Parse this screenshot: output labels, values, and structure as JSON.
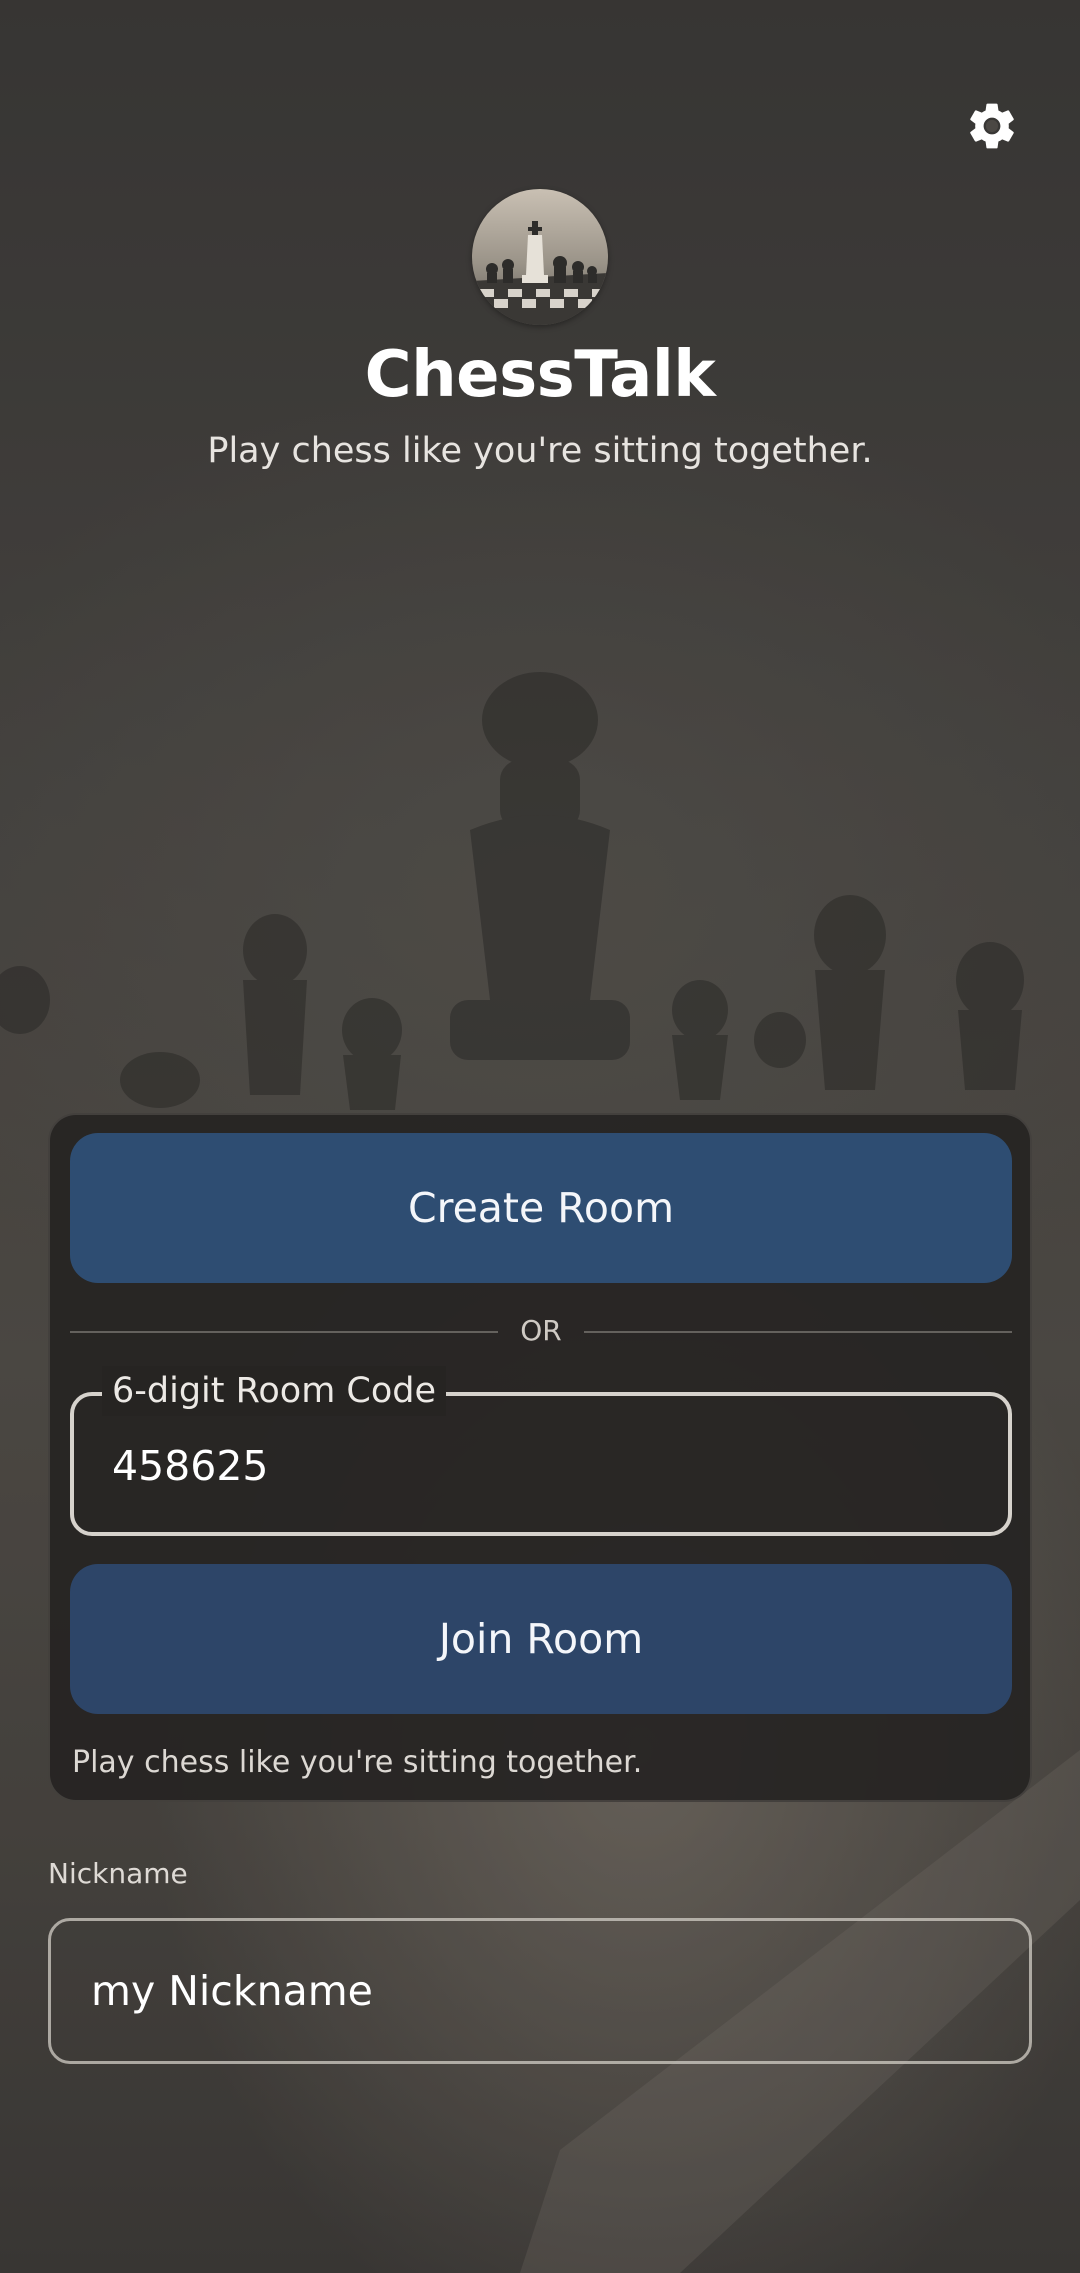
{
  "header": {
    "app_title": "ChessTalk",
    "tagline": "Play chess like you're sitting together."
  },
  "icons": {
    "settings": "gear-icon",
    "logo": "chess-board-logo"
  },
  "room_card": {
    "create_label": "Create Room",
    "divider_label": "OR",
    "code_field_label": "6-digit Room Code",
    "code_value": "458625",
    "join_label": "Join Room",
    "footnote": "Play chess like you're sitting together."
  },
  "nickname": {
    "label": "Nickname",
    "value": "my Nickname"
  },
  "colors": {
    "primary_button": "#2e4d72",
    "card_background": "#262422"
  }
}
